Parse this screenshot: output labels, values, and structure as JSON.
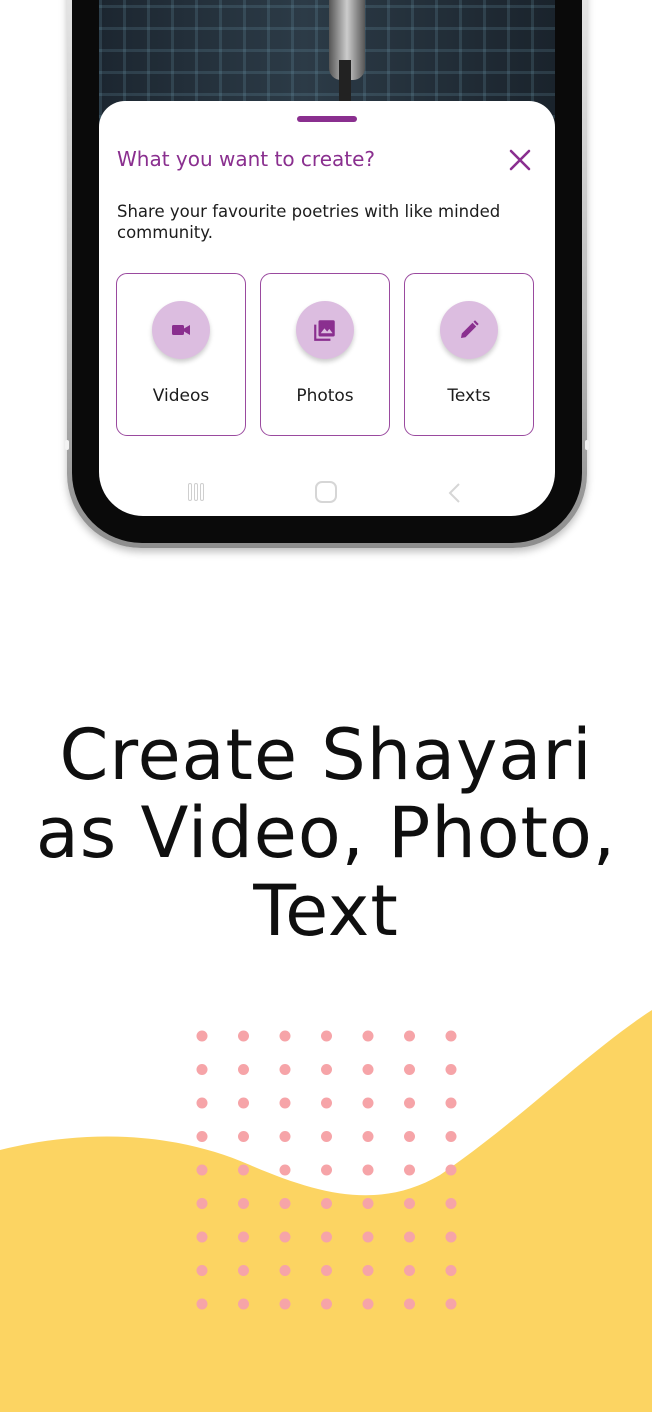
{
  "sheet": {
    "title": "What you want to create?",
    "subtitle": "Share your favourite poetries with like minded community.",
    "options": [
      {
        "label": "Videos",
        "icon": "videocam-icon"
      },
      {
        "label": "Photos",
        "icon": "photo-library-icon"
      },
      {
        "label": "Texts",
        "icon": "pencil-icon"
      }
    ]
  },
  "headline": {
    "line1": "Create Shayari",
    "line2": "as Video, Photo,",
    "line3": "Text"
  },
  "colors": {
    "accent": "#8a2f8f",
    "icon_bg": "#dcbde0",
    "wave": "#fcd462",
    "dots": "#f6a4a8"
  }
}
